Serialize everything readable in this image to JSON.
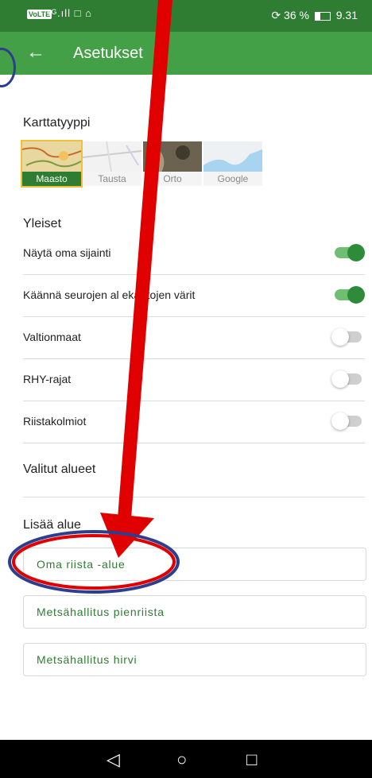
{
  "status_bar": {
    "volte": "VoLTE",
    "signal": "⁴ᴳ.ıll □ ⌂",
    "right_text": "36 %",
    "time": "9.31"
  },
  "app_bar": {
    "title": "Asetukset"
  },
  "map_type": {
    "heading": "Karttatyyppi",
    "options": [
      {
        "label": "Maasto",
        "selected": true
      },
      {
        "label": "Tausta",
        "selected": false
      },
      {
        "label": "Orto",
        "selected": false
      },
      {
        "label": "Google",
        "selected": false
      }
    ]
  },
  "general": {
    "heading": "Yleiset",
    "toggles": [
      {
        "label": "Näytä oma sijainti",
        "on": true
      },
      {
        "label": "Käännä seurojen al  ekarttojen värit",
        "on": true
      },
      {
        "label": "Valtionmaat",
        "on": false
      },
      {
        "label": "RHY-rajat",
        "on": false
      },
      {
        "label": "Riistakolmiot",
        "on": false
      }
    ]
  },
  "selected_areas": {
    "heading": "Valitut alueet"
  },
  "add_area": {
    "heading": "Lisää alue",
    "buttons": [
      "Oma riista -alue",
      "Metsähallitus pienriista",
      "Metsähallitus hirvi"
    ]
  },
  "colors": {
    "status_bar": "#2e7d32",
    "app_bar": "#43a047",
    "accent": "#2e7d32",
    "annotation_red": "#e10000",
    "annotation_blue": "#2b3f8e"
  }
}
